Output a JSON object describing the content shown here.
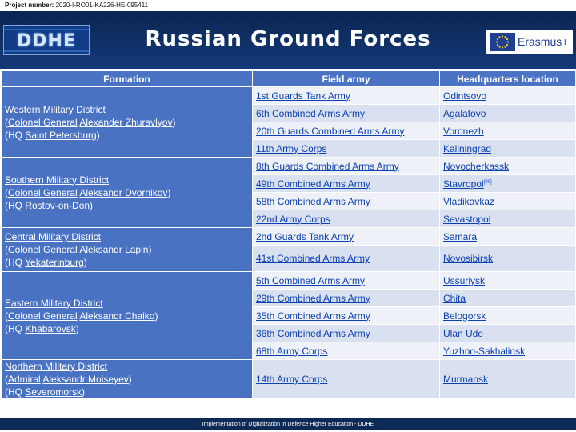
{
  "project": {
    "label": "Project number:",
    "value": "2020-I-RO01-KA226-HE-095411"
  },
  "header": {
    "title": "Russian Ground Forces",
    "logo_left": "DDHE",
    "logo_right": "Erasmus+"
  },
  "table": {
    "headers": {
      "formation": "Formation",
      "army": "Field army",
      "hq": "Headquarters location"
    },
    "rows": [
      {
        "army": "1st Guards Tank Army",
        "hq": "Odintsovo"
      },
      {
        "army": "6th Combined Arms Army",
        "hq": "Agalatovo"
      },
      {
        "army": "20th Guards Combined Arms Army",
        "hq": "Voronezh"
      },
      {
        "army": "11th Army Corps",
        "hq": "Kaliningrad"
      },
      {
        "army": "8th Guards Combined Arms Army",
        "hq": "Novocherkassk"
      },
      {
        "army": "49th Combined Arms Army",
        "hq": "Stavropol",
        "hq_note": "[90]"
      },
      {
        "army": "58th Combined Arms Army",
        "hq": "Vladikavkaz"
      },
      {
        "army": "22nd Army Corps",
        "hq": "Sevastopol"
      },
      {
        "army": "2nd Guards Tank Army",
        "hq": "Samara"
      },
      {
        "army": "41st Combined Arms Army",
        "hq": "Novosibirsk"
      },
      {
        "army": "5th Combined Arms Army",
        "hq": "Ussuriysk"
      },
      {
        "army": "29th Combined Arms Army",
        "hq": "Chita"
      },
      {
        "army": "35th Combined Arms Army",
        "hq": "Belogorsk"
      },
      {
        "army": "36th Combined Arms Army",
        "hq": "Ulan Ude"
      },
      {
        "army": "68th Army Corps",
        "hq": "Yuzhno-Sakhalinsk"
      },
      {
        "army": "14th Army Corps",
        "hq": "Murmansk"
      }
    ],
    "districts": [
      {
        "name": "Western Military District",
        "rank": "Colonel General",
        "commander": "Alexander Zhuravlyov",
        "hq_prefix": "(HQ ",
        "hq_city": "Saint Petersburg"
      },
      {
        "name": "Southern Military District",
        "rank": "Colonel General",
        "commander": "Aleksandr Dvornikov",
        "hq_prefix": "(HQ ",
        "hq_city": "Rostov-on-Don"
      },
      {
        "name": "Central Military District",
        "rank": "Colonel General",
        "commander": "Aleksandr Lapin",
        "hq_prefix": "(HQ ",
        "hq_city": "Yekaterinburg"
      },
      {
        "name": "Eastern Military District",
        "rank": "Colonel General",
        "commander": "Aleksandr Chaiko",
        "hq_prefix": "(HQ ",
        "hq_city": "Khabarovsk"
      },
      {
        "name": "Northern Military District",
        "rank": "Admiral",
        "commander": "Aleksandr Moiseyev",
        "hq_prefix": "(HQ ",
        "hq_city": "Severomorsk"
      }
    ]
  },
  "footer": {
    "text": "Implementation of Digitalization in Defence Higher Education - DDHE"
  },
  "colors": {
    "header_bg": "#0d2a57",
    "formation_bg": "#4a72c2",
    "row_bg": "#d9e0f0",
    "link": "#0b40b0"
  }
}
